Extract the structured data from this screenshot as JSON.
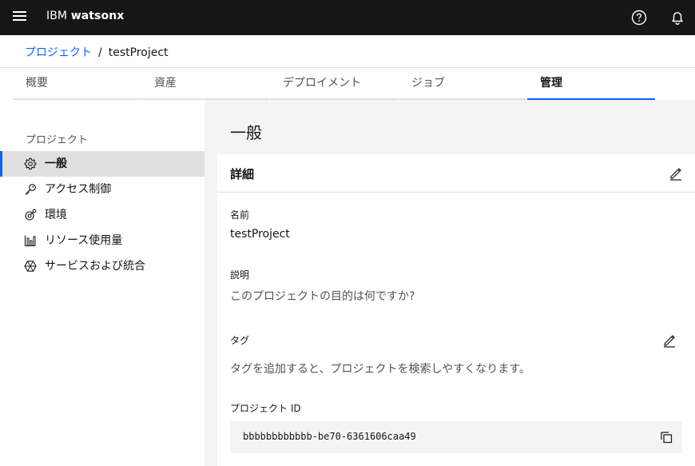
{
  "header": {
    "brand_prefix": "IBM",
    "brand_name": "watsonx",
    "icons": [
      "menu-icon",
      "help-icon",
      "notification-icon"
    ]
  },
  "breadcrumb": {
    "parent": "プロジェクト",
    "separator": "/",
    "current": "testProject"
  },
  "tabs": [
    {
      "label": "概要",
      "active": false
    },
    {
      "label": "資産",
      "active": false
    },
    {
      "label": "デプロイメント",
      "active": false
    },
    {
      "label": "ジョブ",
      "active": false
    },
    {
      "label": "管理",
      "active": true
    }
  ],
  "sidebar": {
    "heading": "プロジェクト",
    "items": [
      {
        "label": "一般",
        "icon": "gear-icon",
        "active": true
      },
      {
        "label": "アクセス制御",
        "icon": "key-icon",
        "active": false
      },
      {
        "label": "環境",
        "icon": "environment-icon",
        "active": false
      },
      {
        "label": "リソース使用量",
        "icon": "bar-chart-icon",
        "active": false
      },
      {
        "label": "サービスおよび統合",
        "icon": "integration-icon",
        "active": false
      }
    ]
  },
  "main": {
    "title": "一般",
    "details": {
      "title": "詳細",
      "name_label": "名前",
      "name_value": "testProject",
      "description_label": "説明",
      "description_placeholder": "このプロジェクトの目的は何ですか?",
      "tags_label": "タグ",
      "tags_placeholder": "タグを追加すると、プロジェクトを検索しやすくなります。",
      "project_id_label": "プロジェクト ID",
      "project_id_value": "bbbbbbbbbbbb-be70-6361606caa49"
    }
  },
  "colors": {
    "header_bg": "#161616",
    "accent": "#0f62fe",
    "active_item_bg": "#e0e0e0",
    "panel_bg": "#f4f4f4"
  }
}
